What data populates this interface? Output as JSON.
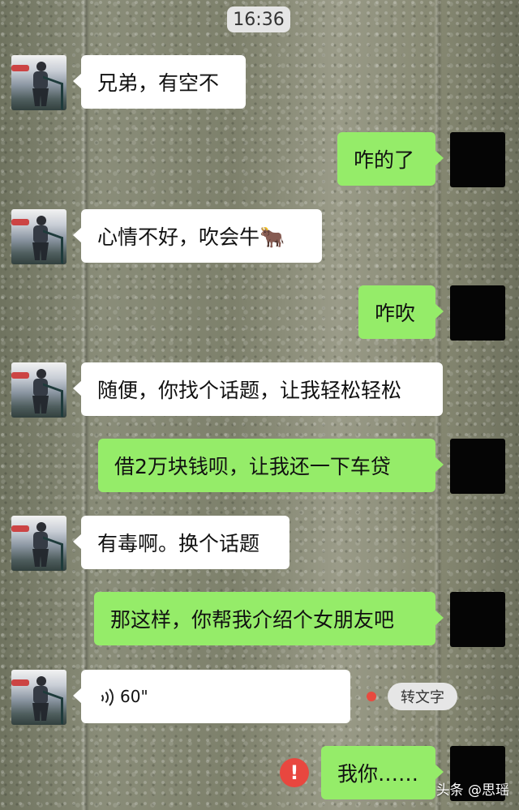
{
  "status_time": "16:36",
  "messages": [
    {
      "from": "other",
      "text": "兄弟，有空不"
    },
    {
      "from": "me",
      "text": "咋的了"
    },
    {
      "from": "other",
      "text": "心情不好，吹会牛🐂"
    },
    {
      "from": "me",
      "text": "咋吹"
    },
    {
      "from": "other",
      "text": "随便，你找个话题，让我轻松轻松"
    },
    {
      "from": "me",
      "text": "借2万块钱呗，让我还一下车贷"
    },
    {
      "from": "other",
      "text": "有毒啊。换个话题"
    },
    {
      "from": "me",
      "text": "那这样，你帮我介绍个女朋友吧"
    },
    {
      "from": "other",
      "type": "voice",
      "duration": "60\""
    },
    {
      "from": "me",
      "text": "我你……"
    }
  ],
  "voice_action": {
    "transcribe_label": "转文字"
  },
  "send_failed_symbol": "!",
  "watermark": "头条 @思瑶"
}
